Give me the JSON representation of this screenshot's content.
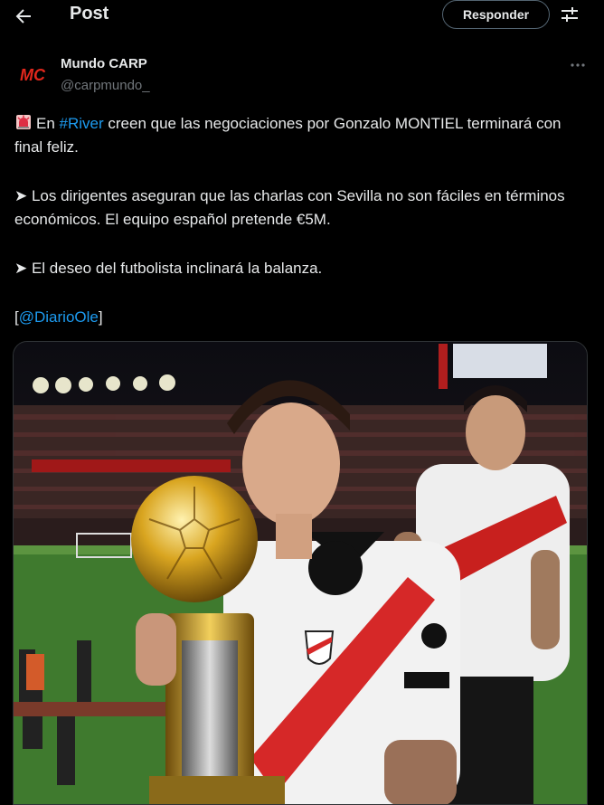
{
  "header": {
    "title": "Post",
    "reply_label": "Responder"
  },
  "author": {
    "name": "Mundo CARP",
    "handle": "@carpmundo_",
    "avatar_text": "MC"
  },
  "tweet": {
    "line1_prefix": "En ",
    "line1_hashtag": "#River",
    "line1_rest": " creen que las negociaciones por Gonzalo MONTIEL terminará con final feliz.",
    "line2": "➤ Los dirigentes aseguran que las charlas con Sevilla no son fáciles en términos económicos. El equipo español pretende €5M.",
    "line3": "➤ El deseo del futbolista inclinará la balanza.",
    "source_open": "[",
    "source_mention": "@DiarioOle",
    "source_close": "]"
  },
  "colors": {
    "background": "#000000",
    "text": "#e7e9ea",
    "secondary": "#71767b",
    "link": "#1d9bf0",
    "river_red": "#d62828"
  },
  "icons": {
    "back": "arrow-left-icon",
    "settings": "sliders-icon",
    "more": "more-horizontal-icon",
    "siren": "siren-emoji-icon"
  },
  "media": {
    "type": "photo"
  }
}
